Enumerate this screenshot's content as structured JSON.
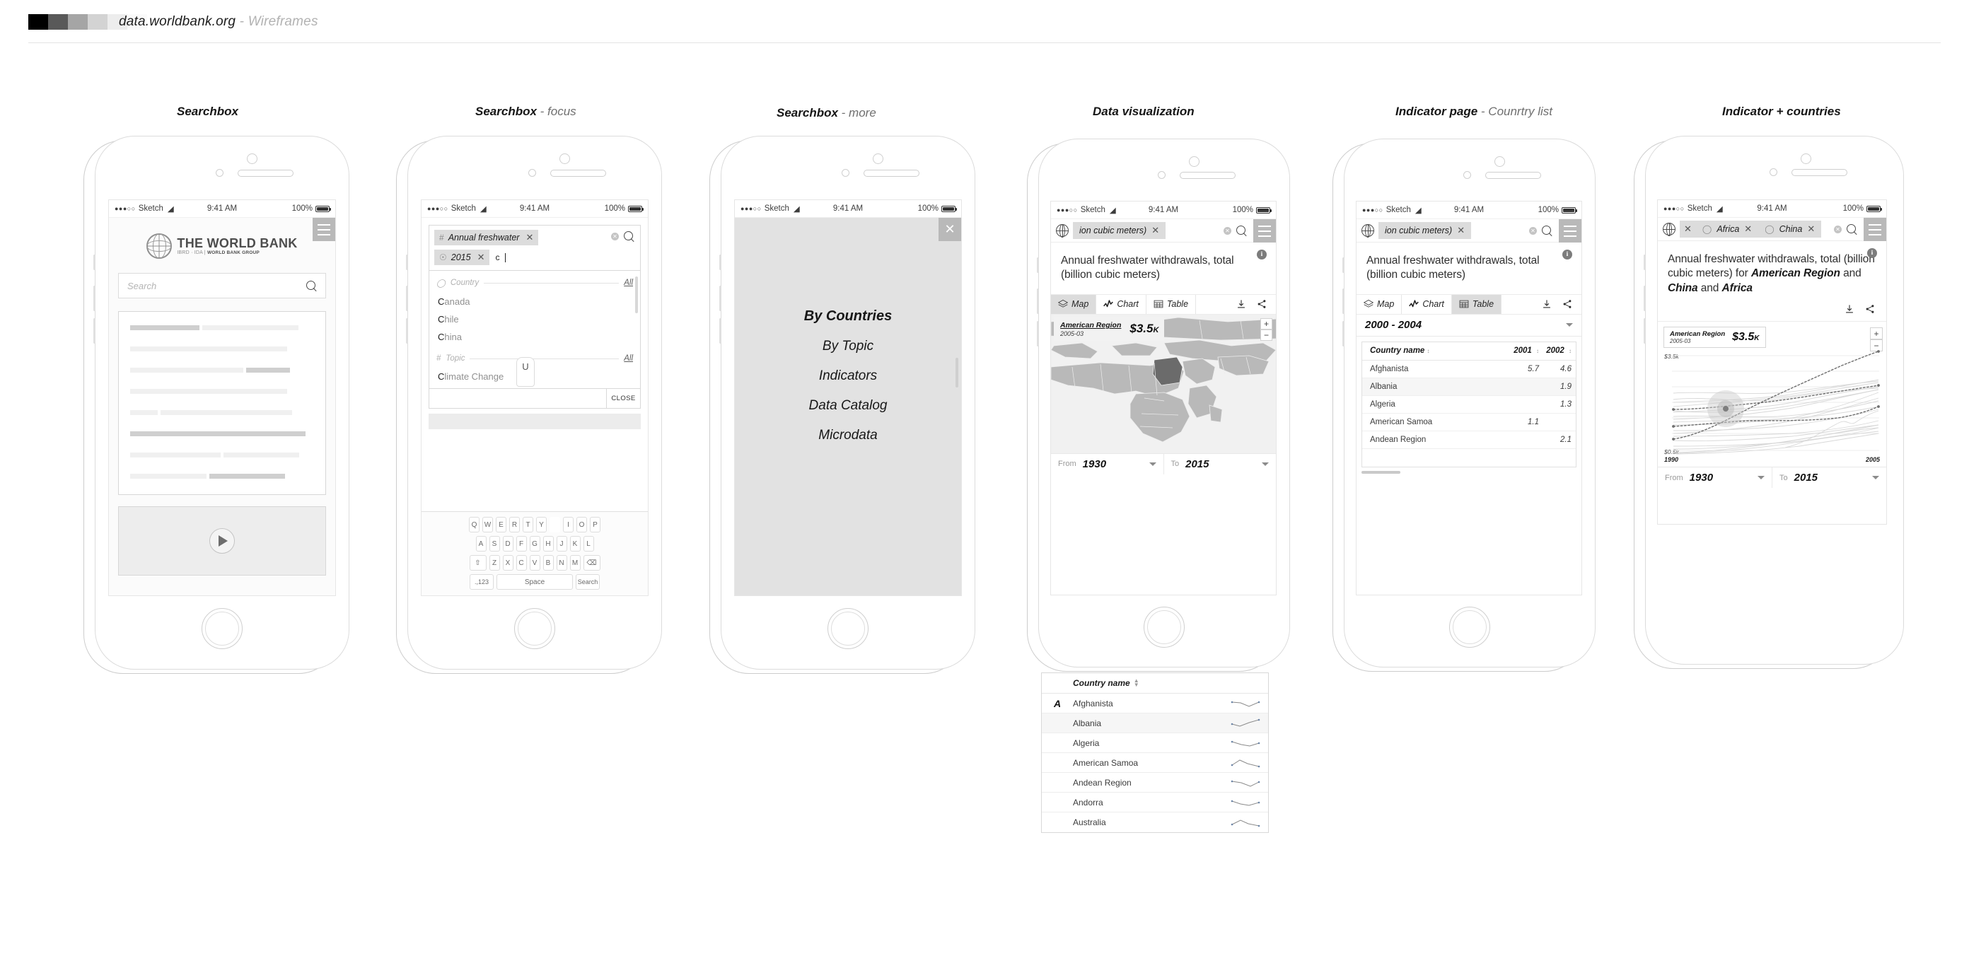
{
  "topbar": {
    "project": "data.worldbank.org",
    "separator": " - ",
    "subtitle": "Wireframes",
    "swatches": [
      "#000000",
      "#595959",
      "#a5a5a5",
      "#d3d3d3",
      "#ededed",
      "#fafafa"
    ]
  },
  "status": {
    "dots": "●●●○○",
    "carrier": "Sketch",
    "clock": "9:41 AM",
    "battery": "100%"
  },
  "screens": [
    {
      "caption": "Searchbox",
      "caption_light": ""
    },
    {
      "caption": "Searchbox",
      "caption_light": " - focus"
    },
    {
      "caption": "Searchbox",
      "caption_light": " - more"
    },
    {
      "caption": "Data visualization",
      "caption_light": ""
    },
    {
      "caption": "Indicator page",
      "caption_light": " - Counrtry list"
    },
    {
      "caption": "Indicator + countries",
      "caption_light": ""
    }
  ],
  "s1": {
    "logo_line1": "THE WORLD BANK",
    "logo_line2_a": "IBRD · IDA  |  ",
    "logo_line2_b": "WORLD BANK GROUP",
    "search_placeholder": "Search",
    "menu_icon": "hamburger-icon",
    "search_icon": "search-icon",
    "play_icon": "play-icon"
  },
  "s2": {
    "chip_indicator_pre": "#",
    "chip_indicator": "Annual freshwater",
    "chip_year_pre": "◔",
    "chip_year": "2015",
    "typed_text": "c",
    "group_country": "Country",
    "group_country_all": "All",
    "group_topic": "Topic",
    "group_topic_all": "All",
    "country_items": [
      {
        "hi": "C",
        "rest": "anada"
      },
      {
        "hi": "C",
        "rest": "hile"
      },
      {
        "hi": "C",
        "rest": "hina"
      }
    ],
    "topic_items": [
      {
        "hi": "C",
        "rest": "limate Change"
      }
    ],
    "close_label": "CLOSE",
    "key_popup": "U",
    "keys_row1": [
      "Q",
      "W",
      "E",
      "R",
      "T",
      "Y",
      "U",
      "I",
      "O",
      "P"
    ],
    "keys_row2": [
      "A",
      "S",
      "D",
      "F",
      "G",
      "H",
      "J",
      "K",
      "L"
    ],
    "keys_row3": [
      "Z",
      "X",
      "C",
      "V",
      "B",
      "N",
      "M"
    ],
    "key_shift": "shift-icon",
    "key_delete": "delete-icon",
    "key_numbers": ".,123",
    "key_space": "Space",
    "key_search": "Search"
  },
  "s3": {
    "close_icon": "close-icon",
    "menu": [
      "By Countries",
      "By Topic",
      "Indicators",
      "Data Catalog",
      "Microdata"
    ]
  },
  "s4": {
    "chip_query": "ion cubic meters)",
    "title": "Annual freshwater withdrawals, total (billion cubic meters)",
    "tabs": [
      {
        "label": "Map",
        "icon": "layers-icon",
        "active": true
      },
      {
        "label": "Chart",
        "icon": "chart-line-icon",
        "active": false
      },
      {
        "label": "Table",
        "icon": "table-icon",
        "active": false
      }
    ],
    "download_icon": "download-icon",
    "share_icon": "share-icon",
    "tooltip_name": "American Region",
    "tooltip_date": "2005-03",
    "tooltip_value": "$3.5",
    "tooltip_unit": "K",
    "zoom_in": "+",
    "zoom_out": "−",
    "range_from_label": "From",
    "range_from_value": "1930",
    "range_to_label": "To",
    "range_to_value": "2015",
    "list_header": "Country name",
    "list_index": "A",
    "countries": [
      "Afghanista",
      "Albania",
      "Algeria",
      "American Samoa",
      "Andean Region",
      "Andorra",
      "Australia"
    ]
  },
  "s5": {
    "chip_query": "ion cubic meters)",
    "title": "Annual freshwater withdrawals, total (billion cubic meters)",
    "tabs": [
      {
        "label": "Map",
        "icon": "layers-icon",
        "active": false
      },
      {
        "label": "Chart",
        "icon": "chart-line-icon",
        "active": false
      },
      {
        "label": "Table",
        "icon": "table-icon",
        "active": true
      }
    ],
    "period": "2000 - 2004",
    "columns": [
      "Country name",
      "2001",
      "2002"
    ],
    "rows": [
      {
        "name": "Afghanista",
        "c2001": "5.7",
        "c2002": "4.6"
      },
      {
        "name": "Albania",
        "c2001": "",
        "c2002": "1.9"
      },
      {
        "name": "Algeria",
        "c2001": "",
        "c2002": "1.3"
      },
      {
        "name": "American Samoa",
        "c2001": "1.1",
        "c2002": ""
      },
      {
        "name": "Andean Region",
        "c2001": "",
        "c2002": "2.1"
      }
    ]
  },
  "s6": {
    "chip_africa": "Africa",
    "chip_china": "China",
    "title_plain": "Annual freshwater withdrawals, total (billion cubic meters) for ",
    "title_b1": "American Region",
    "title_and1": " and ",
    "title_b2": "China",
    "title_and2": " and ",
    "title_b3": "Africa",
    "tooltip_name": "American Region",
    "tooltip_date": "2005-03",
    "tooltip_value": "$3.5",
    "tooltip_unit": "K",
    "range_from_label": "From",
    "range_from_value": "1930",
    "range_to_label": "To",
    "range_to_value": "2015"
  },
  "chart_data": {
    "type": "line",
    "title": "Annual freshwater withdrawals, total (billion cubic meters)",
    "ylabel": "",
    "xlabel": "",
    "ytick_labels": [
      "$3.5k",
      "$0.5k"
    ],
    "xtick_labels": [
      "1990",
      "2005"
    ],
    "ylim": [
      0.5,
      3.5
    ],
    "xlim": [
      1990,
      2005
    ],
    "grid": true,
    "legend": "none",
    "highlight_point": {
      "x": 1995.2,
      "y": 1.93,
      "label": "American Region",
      "date": "2005-03",
      "value": "$3.5K"
    },
    "series": [
      {
        "name": "American Region",
        "style": "dotted-dark",
        "x": [
          1990,
          1991,
          1992,
          1993,
          1994,
          1995,
          1996,
          1997,
          1998,
          1999,
          2000,
          2001,
          2002,
          2003,
          2004,
          2005
        ],
        "values": [
          0.95,
          1.0,
          1.07,
          1.18,
          1.3,
          1.42,
          1.58,
          1.76,
          1.96,
          2.18,
          2.42,
          2.66,
          2.88,
          3.08,
          3.28,
          3.45
        ]
      },
      {
        "name": "China",
        "style": "dotted-dark",
        "x": [
          1990,
          1991,
          1992,
          1993,
          1994,
          1995,
          1996,
          1997,
          1998,
          1999,
          2000,
          2001,
          2002,
          2003,
          2004,
          2005
        ],
        "values": [
          1.98,
          1.96,
          1.95,
          1.95,
          1.96,
          1.98,
          2.01,
          2.05,
          2.1,
          2.16,
          2.22,
          2.3,
          2.38,
          2.47,
          2.55,
          2.6
        ]
      },
      {
        "name": "Africa",
        "style": "dotted-dark",
        "x": [
          1990,
          1991,
          1992,
          1993,
          1994,
          1995,
          1996,
          1997,
          1998,
          1999,
          2000,
          2001,
          2002,
          2003,
          2004,
          2005
        ],
        "values": [
          1.48,
          1.52,
          1.58,
          1.63,
          1.66,
          1.68,
          1.68,
          1.67,
          1.66,
          1.65,
          1.65,
          1.67,
          1.72,
          1.8,
          1.9,
          2.0
        ]
      },
      {
        "name": "other",
        "style": "faint",
        "values": [
          2.6,
          2.58,
          2.62,
          2.66,
          2.64,
          2.6,
          2.58,
          2.56,
          2.55,
          2.56,
          2.6,
          2.66,
          2.74,
          2.82,
          2.88,
          2.92
        ]
      },
      {
        "name": "other",
        "style": "faint",
        "values": [
          2.4,
          2.42,
          2.44,
          2.42,
          2.4,
          2.38,
          2.4,
          2.44,
          2.5,
          2.56,
          2.62,
          2.68,
          2.74,
          2.8,
          2.86,
          2.9
        ]
      },
      {
        "name": "other",
        "style": "faint",
        "values": [
          2.2,
          2.22,
          2.24,
          2.26,
          2.28,
          2.32,
          2.38,
          2.44,
          2.5,
          2.56,
          2.62,
          2.68,
          2.74,
          2.78,
          2.82,
          2.86
        ]
      },
      {
        "name": "other",
        "style": "faint",
        "values": [
          1.3,
          1.3,
          1.31,
          1.32,
          1.33,
          1.34,
          1.35,
          1.36,
          1.38,
          1.4,
          1.42,
          1.45,
          1.48,
          1.52,
          1.58,
          1.66
        ]
      },
      {
        "name": "other",
        "style": "faint",
        "values": [
          1.05,
          1.06,
          1.07,
          1.08,
          1.09,
          1.1,
          1.11,
          1.13,
          1.15,
          1.18,
          1.22,
          1.28,
          1.36,
          1.46,
          1.58,
          1.7
        ]
      },
      {
        "name": "other",
        "style": "faint",
        "values": [
          0.62,
          0.64,
          0.66,
          0.68,
          0.7,
          0.74,
          0.8,
          0.88,
          0.98,
          1.1,
          1.22,
          1.32,
          1.4,
          1.48,
          1.56,
          1.64
        ]
      },
      {
        "name": "other",
        "style": "faint",
        "values": [
          0.55,
          0.56,
          0.58,
          0.6,
          0.62,
          0.64,
          0.68,
          0.74,
          0.82,
          0.92,
          1.04,
          1.16,
          1.26,
          1.34,
          1.42,
          1.5
        ]
      }
    ]
  }
}
